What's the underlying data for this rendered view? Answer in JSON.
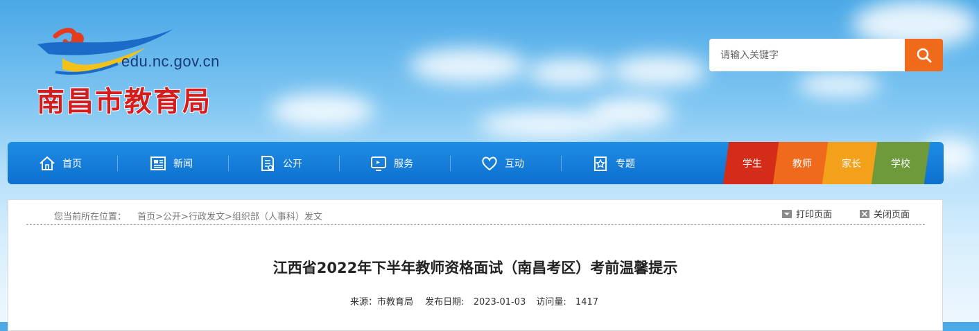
{
  "header": {
    "logo_url": "edu.nc.gov.cn",
    "logo_title": "南昌市教育局"
  },
  "search": {
    "placeholder": "请输入关键字",
    "button_icon": "search-icon",
    "accent": "#f06a1c"
  },
  "nav": {
    "items": [
      {
        "label": "首页",
        "icon": "home-icon"
      },
      {
        "label": "新闻",
        "icon": "newspaper-icon"
      },
      {
        "label": "公开",
        "icon": "document-icon"
      },
      {
        "label": "服务",
        "icon": "monitor-icon"
      },
      {
        "label": "互动",
        "icon": "heart-icon"
      },
      {
        "label": "专题",
        "icon": "star-document-icon"
      }
    ],
    "audiences": [
      {
        "label": "学生",
        "color": "#d42c18"
      },
      {
        "label": "教师",
        "color": "#ef6a1c"
      },
      {
        "label": "家长",
        "color": "#f3a11a"
      },
      {
        "label": "学校",
        "color": "#6e9a3c"
      }
    ]
  },
  "breadcrumb": {
    "label": "您当前所在位置：",
    "path": "首页>公开>行政发文>组织部（人事科）发文"
  },
  "tools": {
    "print": "打印页面",
    "close": "关闭页面"
  },
  "article": {
    "title": "江西省2022年下半年教师资格面试（南昌考区）考前温馨提示",
    "source_label": "来源：",
    "source": "市教育局",
    "date_label": "发布日期:",
    "date": "2023-01-03",
    "views_label": "访问量:",
    "views": "1417"
  }
}
